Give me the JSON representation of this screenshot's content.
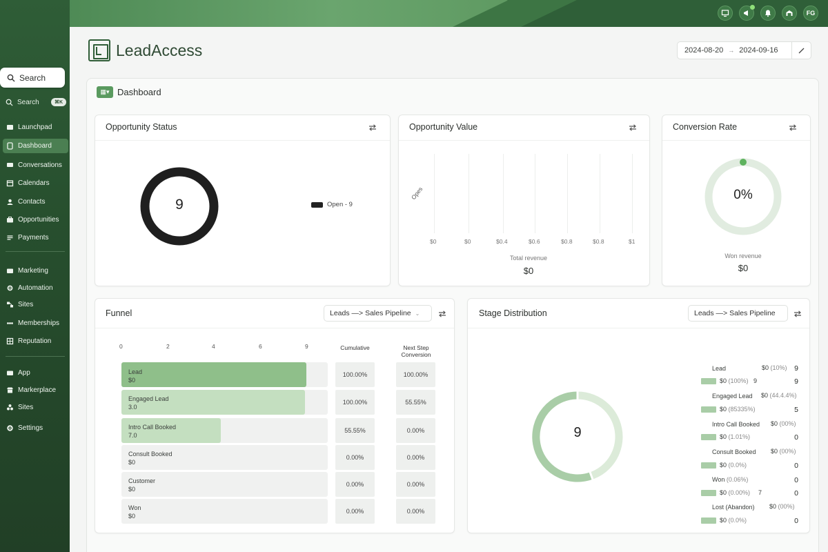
{
  "topbar": {
    "icons": [
      "monitor-icon",
      "megaphone-icon",
      "bell-icon",
      "garage-icon"
    ],
    "avatar_initials": "FG"
  },
  "sidebar": {
    "search_button": "Search",
    "search_link": "Search",
    "search_shortcut": "⌘K",
    "items": [
      {
        "label": "Launchpad",
        "icon": "launchpad-icon"
      },
      {
        "label": "Dashboard",
        "icon": "dashboard-icon",
        "active": true
      },
      {
        "label": "Conversations",
        "icon": "conversations-icon"
      },
      {
        "label": "Calendars",
        "icon": "calendar-icon"
      },
      {
        "label": "Contacts",
        "icon": "contacts-icon"
      },
      {
        "label": "Opportunities",
        "icon": "opportunities-icon"
      },
      {
        "label": "Payments",
        "icon": "payments-icon"
      },
      {
        "label": "Marketing",
        "icon": "marketing-icon"
      },
      {
        "label": "Automation",
        "icon": "automation-icon"
      },
      {
        "label": "Sites",
        "icon": "sites-icon"
      },
      {
        "label": "Memberships",
        "icon": "memberships-icon"
      },
      {
        "label": "Reputation",
        "icon": "reputation-icon"
      },
      {
        "label": "App",
        "icon": "app-icon"
      },
      {
        "label": "Markerplace",
        "icon": "marketplace-icon"
      },
      {
        "label": "Sites",
        "icon": "sites-icon"
      },
      {
        "label": "Settings",
        "icon": "settings-icon"
      }
    ]
  },
  "header": {
    "app_name": "LeadAccess",
    "date_start": "2024-08-20",
    "date_end": "2024-09-16",
    "date_arrow": "→"
  },
  "dashboard": {
    "title": "Dashboard"
  },
  "opportunity_status": {
    "title": "Opportunity Status",
    "total": "9",
    "legend": "Open - 9"
  },
  "opportunity_value": {
    "title": "Opportunity Value",
    "y_label": "Opes",
    "x_ticks": [
      "$0",
      "$0",
      "$0.4",
      "$0.6",
      "$0.8",
      "$0.8",
      "$1"
    ],
    "caption": "Total revenue",
    "value": "$0"
  },
  "conversion_rate": {
    "title": "Conversion Rate",
    "value": "0%",
    "caption": "Won revenue",
    "amount": "$0",
    "rate": 0
  },
  "funnel": {
    "title": "Funnel",
    "pipeline": "Leads —> Sales Pipeline",
    "axis": [
      "0",
      "2",
      "4",
      "6",
      "9"
    ],
    "col_cumulative": "Cumulative",
    "col_next_1": "Next Step",
    "col_next_2": "Conversion",
    "rows": [
      {
        "name": "Lead",
        "amount": "$0",
        "fill": 0.895,
        "cumulative": "100.00%",
        "next": "100.00%"
      },
      {
        "name": "Engaged Lead",
        "amount": "3.0",
        "fill": 0.89,
        "cumulative": "100.00%",
        "next": "55.55%"
      },
      {
        "name": "Intro Call Booked",
        "amount": "7.0",
        "fill": 0.48,
        "cumulative": "55.55%",
        "next": "0.00%"
      },
      {
        "name": "Consult Booked",
        "amount": "$0",
        "fill": 0,
        "cumulative": "0.00%",
        "next": "0.00%"
      },
      {
        "name": "Customer",
        "amount": "$0",
        "fill": 0,
        "cumulative": "0.00%",
        "next": "0.00%"
      },
      {
        "name": "Won",
        "amount": "$0",
        "fill": 0,
        "cumulative": "0.00%",
        "next": "0.00%"
      }
    ]
  },
  "stage_distribution": {
    "title": "Stage Distribution",
    "pipeline": "Leads —> Sales Pipeline",
    "total": "9",
    "stages": [
      {
        "name": "Lead",
        "value": "$0",
        "pct": "(10%)",
        "count": "9",
        "sub_value": "$0",
        "sub_pct": "(100%)",
        "sub_extra": "9",
        "sub_count": "9"
      },
      {
        "name": "Engaged Lead",
        "value": "$0",
        "pct": "(44.4.4%)",
        "count": "",
        "sub_value": "$0",
        "sub_pct": "(85335%)",
        "sub_extra": "",
        "sub_count": "5"
      },
      {
        "name": "Intro Call Booked",
        "value": "$0",
        "pct": "(00%)",
        "count": "",
        "sub_value": "$0",
        "sub_pct": "(1.01%)",
        "sub_extra": "",
        "sub_count": "0"
      },
      {
        "name": "Consult Booked",
        "value": "$0",
        "pct": "(00%)",
        "count": "",
        "sub_value": "$0",
        "sub_pct": "(0.0%)",
        "sub_extra": "",
        "sub_count": "0"
      },
      {
        "name": "Won",
        "value": "",
        "pct": "(0.06%)",
        "count": "0",
        "sub_value": "$0",
        "sub_pct": "(0.00%)",
        "sub_extra": "7",
        "sub_count": "0"
      },
      {
        "name": "Lost (Abandon)",
        "value": "$0",
        "pct": "(00%)",
        "count": "",
        "sub_value": "$0",
        "sub_pct": "(0.0%)",
        "sub_extra": "",
        "sub_count": "0"
      }
    ]
  },
  "colors": {
    "brand_dark": "#2f5d37",
    "funnel_strong": "#8fbf8a",
    "funnel_light": "#c4dfc0",
    "donut_light": "#b7d8b3"
  }
}
